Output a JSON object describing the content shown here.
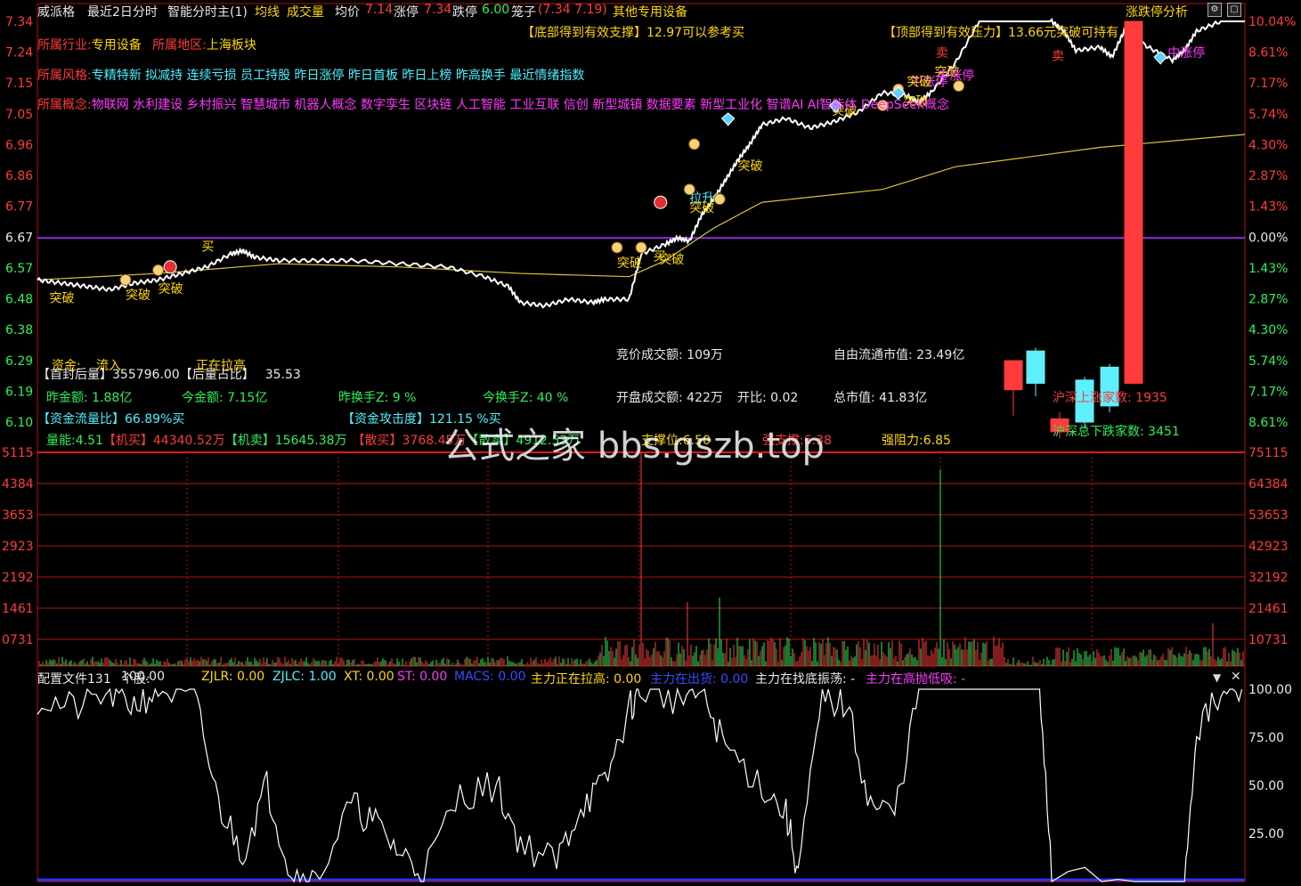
{
  "header": {
    "stock_name": "威派格",
    "period": "最近2日分时",
    "indicator": "智能分时主(1)",
    "avg_line": "均线",
    "volume": "成交量",
    "avg_price_label": "均价",
    "avg_price": "7.14",
    "limit_up_label": "涨停",
    "limit_up": "7.34",
    "limit_down_label": "跌停",
    "limit_down": "6.00",
    "cage_label": "笼子",
    "cage_value": "(7.34 7.19)",
    "sector": "其他专用设备",
    "panel_link": "涨跌停分析"
  },
  "info": {
    "industry_label": "所属行业:",
    "industry": "专用设备",
    "region_label": "所属地区:",
    "region": "上海板块",
    "style_label": "所属风格:",
    "style": "专精特新 拟减持 连续亏损 员工持股 昨日涨停 昨日首板 昨日上榜 昨高换手 最近情绪指数",
    "concept_label": "所属概念:",
    "concept": "物联网 水利建设 乡村振兴 智慧城市 机器人概念 数字孪生 区块链 人工智能 工业互联 信创 新型城镇 数据要素 新型工业化 智谱AI AI智能体 DeepSeek概念",
    "support_note": "【底部得到有效支撑】12.97可以参考买",
    "pressure_note": "【顶部得到有效压力】13.66元突破可持有"
  },
  "stats": {
    "fund_label": "资金:",
    "fund_value": "流入",
    "rally": "正在拉高",
    "first_seal_label": "【首封后量】",
    "first_seal_value": "355796.00",
    "post_ratio_label": "【后量占比】",
    "post_ratio_value": "35.53",
    "prev_amount_label": "昨金额:",
    "prev_amount": "1.88亿",
    "today_amount_label": "今金额:",
    "today_amount": "7.15亿",
    "prev_turnover_label": "昨换手Z:",
    "prev_turnover": "9 %",
    "today_turnover_label": "今换手Z:",
    "today_turnover": "40 %",
    "flow_ratio_label": "【资金流量比】",
    "flow_ratio": "66.89%买",
    "attack_label": "【资金攻击度】",
    "attack": "121.15 %买",
    "energy_label": "量能:",
    "energy": "4.51",
    "inst_buy_label": "【机买】",
    "inst_buy": "44340.52万",
    "inst_sell_label": "【机卖】",
    "inst_sell": "15645.38万",
    "retail_buy_label": "【散买】",
    "retail_buy": "3768.45万",
    "retail_sell_label": "【散卖】",
    "retail_sell": "4912.53万",
    "support_label": "支撑位:",
    "support": "6.50",
    "strong_support_label": "强支撑:",
    "strong_support": "6.38",
    "resistance_label": "强阻力:",
    "resistance": "6.85",
    "auction_label": "竞价成交额:",
    "auction": "109万",
    "open_amount_label": "开盘成交额:",
    "open_amount": "422万",
    "open_ratio_label": "开比:",
    "open_ratio": "0.02",
    "float_cap_label": "自由流通市值:",
    "float_cap": "23.49亿",
    "total_cap_label": "总市值:",
    "total_cap": "41.83亿",
    "up_count_label": "沪深上涨家数:",
    "up_count": "1935",
    "down_count_label": "沪深总下跌家数:",
    "down_count": "3451"
  },
  "signals": {
    "breakout": "突破",
    "buy": "买",
    "sell": "卖",
    "lift": "拉升",
    "mid_limit": "中涨停"
  },
  "indicator_panel": {
    "file_label": "配置文件131",
    "stock_label": "个股:",
    "stock_value": "100.00",
    "zjlr": "ZJLR: 0.00",
    "zjlc": "ZJLC: 1.00",
    "xt": "XT: 0.00",
    "st": "ST: 0.00",
    "macs": "MACS: 0.00",
    "lifting": "主力正在拉高: 0.00",
    "shipping": "主力在出货: 0.00",
    "bottom": "主力在找底振荡: -",
    "high_absorb": "主力在高抛低吸: -"
  },
  "watermark": "公式之家 bbs.gszb.top",
  "colors": {
    "up": "#ff3b3b",
    "down": "#2ef05a",
    "price_line": "#ffffff",
    "avg_line": "#d8c43a",
    "prev_close": "#8a2be2",
    "grid": "#b01515",
    "label_yellow": "#ffd700",
    "label_magenta": "#ff38ff",
    "label_cyan": "#4cf2ff"
  },
  "chart_data": {
    "type": "line",
    "price_axis": {
      "left_ticks": [
        "7.34",
        "7.24",
        "7.15",
        "7.05",
        "6.96",
        "6.86",
        "6.77",
        "6.67",
        "6.57",
        "6.48",
        "6.38",
        "6.29",
        "6.19",
        "6.10"
      ],
      "right_ticks": [
        "10.04%",
        "8.61%",
        "7.17%",
        "5.74%",
        "4.30%",
        "2.87%",
        "1.43%",
        "0.00%",
        "1.43%",
        "2.87%",
        "4.30%",
        "5.74%",
        "7.17%",
        "8.61%"
      ],
      "prev_close": 6.67
    },
    "volume_axis": {
      "left_ticks": [
        "5115",
        "4384",
        "3653",
        "2923",
        "2192",
        "1461",
        "0731"
      ],
      "right_ticks": [
        "75115",
        "64384",
        "53653",
        "42923",
        "32192",
        "21461",
        "10731"
      ]
    },
    "indicator_axis": {
      "right_ticks": [
        "100.00",
        "75.00",
        "50.00",
        "25.00"
      ]
    },
    "price_series": [
      [
        0,
        6.54
      ],
      [
        0.02,
        6.53
      ],
      [
        0.04,
        6.52
      ],
      [
        0.06,
        6.51
      ],
      [
        0.08,
        6.53
      ],
      [
        0.1,
        6.54
      ],
      [
        0.12,
        6.56
      ],
      [
        0.14,
        6.58
      ],
      [
        0.16,
        6.62
      ],
      [
        0.17,
        6.63
      ],
      [
        0.18,
        6.61
      ],
      [
        0.2,
        6.6
      ],
      [
        0.23,
        6.6
      ],
      [
        0.26,
        6.6
      ],
      [
        0.3,
        6.59
      ],
      [
        0.34,
        6.58
      ],
      [
        0.37,
        6.55
      ],
      [
        0.39,
        6.52
      ],
      [
        0.4,
        6.47
      ],
      [
        0.42,
        6.46
      ],
      [
        0.44,
        6.48
      ],
      [
        0.46,
        6.47
      ],
      [
        0.47,
        6.48
      ],
      [
        0.49,
        6.48
      ],
      [
        0.5,
        6.62
      ],
      [
        0.52,
        6.65
      ],
      [
        0.53,
        6.67
      ],
      [
        0.54,
        6.66
      ],
      [
        0.55,
        6.74
      ],
      [
        0.56,
        6.79
      ],
      [
        0.57,
        6.85
      ],
      [
        0.58,
        6.91
      ],
      [
        0.59,
        6.96
      ],
      [
        0.6,
        7.02
      ],
      [
        0.62,
        7.04
      ],
      [
        0.64,
        7.01
      ],
      [
        0.66,
        7.03
      ],
      [
        0.68,
        7.06
      ],
      [
        0.7,
        7.12
      ],
      [
        0.72,
        7.11
      ],
      [
        0.73,
        7.09
      ],
      [
        0.74,
        7.12
      ],
      [
        0.76,
        7.21
      ],
      [
        0.78,
        7.34
      ],
      [
        0.8,
        7.34
      ],
      [
        0.82,
        7.34
      ],
      [
        0.84,
        7.34
      ],
      [
        0.85,
        7.31
      ],
      [
        0.86,
        7.25
      ],
      [
        0.88,
        7.26
      ],
      [
        0.89,
        7.23
      ],
      [
        0.9,
        7.31
      ],
      [
        0.92,
        7.26
      ],
      [
        0.94,
        7.22
      ],
      [
        0.95,
        7.25
      ],
      [
        0.96,
        7.31
      ],
      [
        0.98,
        7.34
      ],
      [
        1,
        7.34
      ]
    ],
    "avg_series": [
      [
        0,
        6.54
      ],
      [
        0.1,
        6.56
      ],
      [
        0.2,
        6.59
      ],
      [
        0.3,
        6.58
      ],
      [
        0.4,
        6.56
      ],
      [
        0.49,
        6.55
      ],
      [
        0.52,
        6.6
      ],
      [
        0.56,
        6.7
      ],
      [
        0.6,
        6.78
      ],
      [
        0.7,
        6.82
      ],
      [
        0.76,
        6.89
      ],
      [
        0.82,
        6.92
      ],
      [
        0.88,
        6.95
      ],
      [
        0.94,
        6.97
      ],
      [
        1,
        6.99
      ]
    ],
    "sidebar_candles": [
      {
        "open": 6.29,
        "close": 6.2,
        "high": 6.29,
        "low": 6.12
      },
      {
        "open": 6.22,
        "close": 6.32,
        "high": 6.33,
        "low": 6.18
      },
      {
        "open": 6.11,
        "close": 6.07,
        "high": 6.13,
        "low": 6.05
      },
      {
        "open": 6.1,
        "close": 6.23,
        "high": 6.24,
        "low": 6.08
      },
      {
        "open": 6.15,
        "close": 6.27,
        "high": 6.28,
        "low": 6.13
      },
      {
        "open": 6.22,
        "close": 7.34,
        "high": 7.34,
        "low": 6.22
      }
    ],
    "volume_bars_scale": 75115
  }
}
